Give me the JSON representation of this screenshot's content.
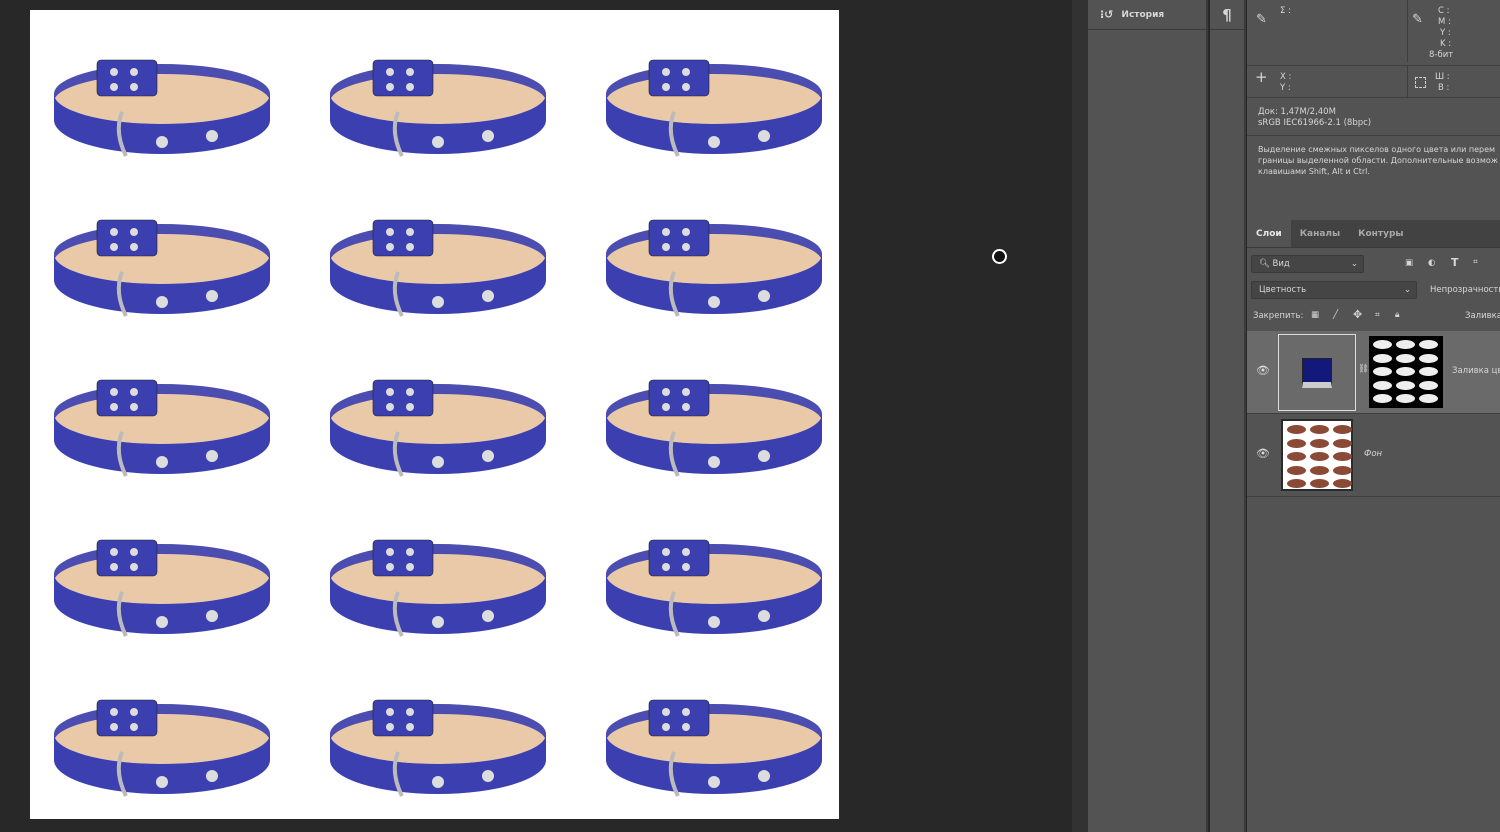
{
  "canvas": {
    "collar_color": "#3b3fb0",
    "count": 15
  },
  "history_panel": {
    "title": "История",
    "icon": "history-icon"
  },
  "paragraph_panel": {
    "icon": "paragraph-icon",
    "glyph": "¶"
  },
  "info_panel": {
    "sigma": "Σ :",
    "cmyk": [
      "C :",
      "M :",
      "Y :",
      "K :"
    ],
    "bits": "8-бит",
    "xy": [
      "X :",
      "Y :"
    ],
    "wh": [
      "Ш :",
      "В :"
    ],
    "doc": "Док: 1,47M/2,40M",
    "profile": "sRGB IEC61966-2.1 (8bpc)",
    "hint": [
      "Выделение смежных пикселов одного цвета или перем",
      "границы выделенной области. Дополнительные возмож",
      "клавишами Shift, Alt и Ctrl."
    ]
  },
  "layers_panel": {
    "tabs": [
      {
        "label": "Слои",
        "active": true
      },
      {
        "label": "Каналы"
      },
      {
        "label": "Контуры"
      }
    ],
    "filter": "Вид",
    "blend_mode": "Цветность",
    "opacity_label": "Непрозрачность",
    "lock_label": "Закрепить:",
    "fill_label": "Заливка",
    "layers": [
      {
        "name": "Заливка цв",
        "fill_color": "#13197a",
        "visible": true
      },
      {
        "name": "Фон",
        "visible": true
      }
    ]
  }
}
